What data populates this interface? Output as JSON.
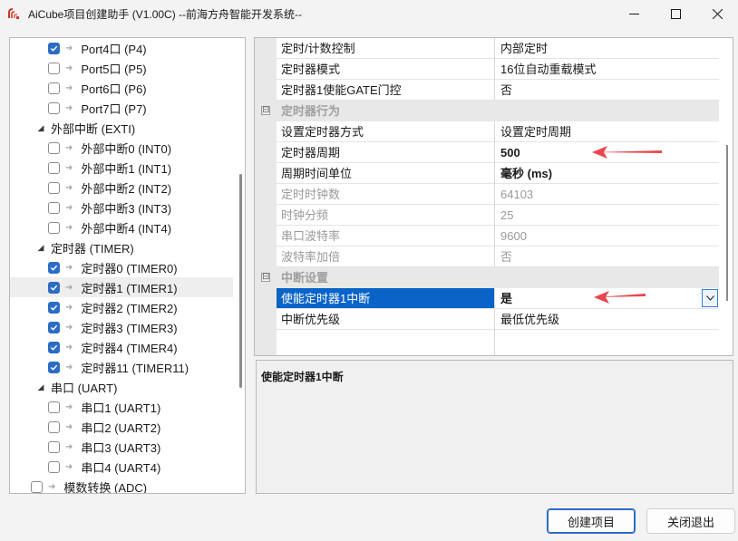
{
  "window": {
    "title": "AiCube项目创建助手 (V1.00C) --前海方舟智能开发系统--",
    "controls": {
      "minimize": "—",
      "maximize": "□",
      "close": "✕"
    }
  },
  "tree": {
    "nodes": [
      {
        "label": "Port4口 (P4)",
        "checked": true
      },
      {
        "label": "Port5口 (P5)",
        "checked": false
      },
      {
        "label": "Port6口 (P6)",
        "checked": false
      },
      {
        "label": "Port7口 (P7)",
        "checked": false
      },
      {
        "label": "外部中断 (EXTI)",
        "group": true
      },
      {
        "label": "外部中断0 (INT0)",
        "checked": false
      },
      {
        "label": "外部中断1 (INT1)",
        "checked": false
      },
      {
        "label": "外部中断2 (INT2)",
        "checked": false
      },
      {
        "label": "外部中断3 (INT3)",
        "checked": false
      },
      {
        "label": "外部中断4 (INT4)",
        "checked": false
      },
      {
        "label": "定时器 (TIMER)",
        "group": true
      },
      {
        "label": "定时器0 (TIMER0)",
        "checked": true
      },
      {
        "label": "定时器1 (TIMER1)",
        "checked": true,
        "selected": true
      },
      {
        "label": "定时器2 (TIMER2)",
        "checked": true
      },
      {
        "label": "定时器3 (TIMER3)",
        "checked": true
      },
      {
        "label": "定时器4 (TIMER4)",
        "checked": true
      },
      {
        "label": "定时器11 (TIMER11)",
        "checked": true
      },
      {
        "label": "串口 (UART)",
        "group": true
      },
      {
        "label": "串口1 (UART1)",
        "checked": false
      },
      {
        "label": "串口2 (UART2)",
        "checked": false
      },
      {
        "label": "串口3 (UART3)",
        "checked": false
      },
      {
        "label": "串口4 (UART4)",
        "checked": false
      },
      {
        "label": "模数转换 (ADC)",
        "checked": false,
        "root": true
      }
    ]
  },
  "properties": {
    "rows": [
      {
        "name": "定时/计数控制",
        "value": "内部定时"
      },
      {
        "name": "定时器模式",
        "value": "16位自动重载模式"
      },
      {
        "name": "定时器1使能GATE门控",
        "value": "否"
      },
      {
        "category": "定时器行为"
      },
      {
        "name": "设置定时器方式",
        "value": "设置定时周期"
      },
      {
        "name": "定时器周期",
        "value": "500",
        "bold": true
      },
      {
        "name": "周期时间单位",
        "value": "毫秒 (ms)",
        "bold": true
      },
      {
        "name": "定时时钟数",
        "value": "64103",
        "dim": true
      },
      {
        "name": "时钟分频",
        "value": "25",
        "dim": true
      },
      {
        "name": "串口波特率",
        "value": "9600",
        "dim": true
      },
      {
        "name": "波特率加倍",
        "value": "否",
        "dim": true
      },
      {
        "category": "中断设置"
      },
      {
        "name": "使能定时器1中断",
        "value": "是",
        "bold": true,
        "selected": true
      },
      {
        "name": "中断优先级",
        "value": "最低优先级"
      }
    ],
    "collapse_symbol": "⊟"
  },
  "description": {
    "title": "使能定时器1中断"
  },
  "buttons": {
    "create": "创建项目",
    "close": "关闭退出"
  },
  "colors": {
    "accent": "#0a64c8",
    "annotation": "#e8474f",
    "checkbox": "#2b6cc4"
  }
}
